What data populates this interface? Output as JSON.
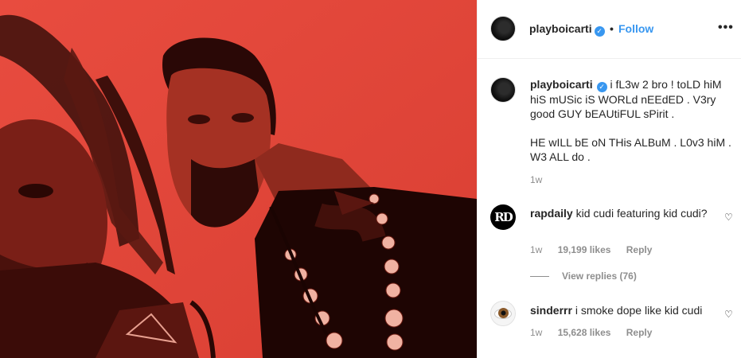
{
  "post": {
    "username": "playboicarti",
    "follow_label": "Follow",
    "dot": "•",
    "more_label": "•••",
    "caption_line1": "i fL3w 2 bro ! toLD hiM hiS mUSic iS WORLd nEEdED . V3ry good GUY bEAUtiFUL sPirit .",
    "caption_line2": "HE wILL bE oN THis ALBuM . L0v3 hiM . W3 ALL do .",
    "caption_time": "1w"
  },
  "comments": [
    {
      "avatar_text": "RD",
      "username": "rapdaily",
      "text": "kid cudi featuring kid cudi?",
      "time": "1w",
      "likes": "19,199 likes",
      "reply": "Reply",
      "view_replies": "View replies (76)"
    },
    {
      "username": "sinderrr",
      "text": "i smoke dope like kid cudi",
      "time": "1w",
      "likes": "15,628 likes",
      "reply": "Reply"
    }
  ],
  "icons": {
    "verified": "verified-badge-icon",
    "heart": "heart-outline-icon",
    "more": "more-options-icon"
  },
  "colors": {
    "accent": "#3897f0",
    "photo_tint": "#e2493d",
    "muted": "#8e8e8e"
  }
}
